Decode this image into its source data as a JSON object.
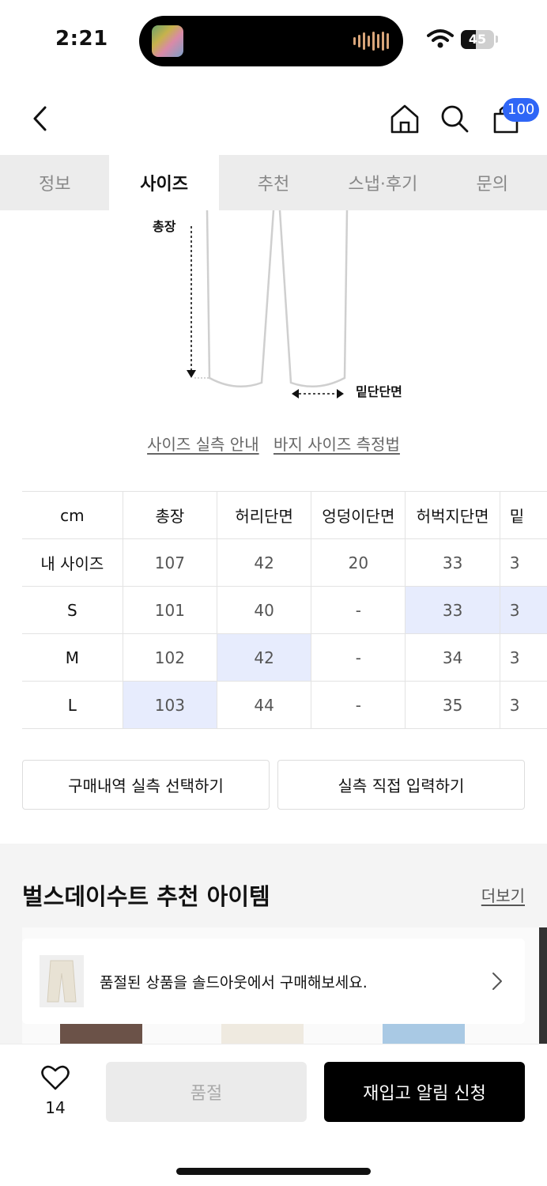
{
  "status_bar": {
    "time": "2:21",
    "battery": "45",
    "battery_level": 0.45
  },
  "header": {
    "cart_count": "100"
  },
  "tabs": [
    {
      "label": "정보",
      "active": false
    },
    {
      "label": "사이즈",
      "active": true
    },
    {
      "label": "추천",
      "active": false
    },
    {
      "label": "스냅·후기",
      "active": false
    },
    {
      "label": "문의",
      "active": false
    }
  ],
  "diagram": {
    "total_length_label": "총장",
    "hem_label": "밑단단면"
  },
  "links": {
    "size_guide": "사이즈 실측 안내",
    "measure_guide": "바지 사이즈 측정법"
  },
  "size_table": {
    "headers": [
      "cm",
      "총장",
      "허리단면",
      "엉덩이단면",
      "허벅지단면",
      "밑"
    ],
    "rows": [
      {
        "label": "내 사이즈",
        "cells": [
          "107",
          "42",
          "20",
          "33",
          "3"
        ]
      },
      {
        "label": "S",
        "cells": [
          "101",
          "40",
          "-",
          "33",
          "3"
        ]
      },
      {
        "label": "M",
        "cells": [
          "102",
          "42",
          "-",
          "34",
          "3"
        ]
      },
      {
        "label": "L",
        "cells": [
          "103",
          "44",
          "-",
          "35",
          "3"
        ]
      }
    ]
  },
  "buttons": {
    "purchase_history": "구매내역 실측 선택하기",
    "direct_input": "실측 직접 입력하기"
  },
  "recommend": {
    "title": "벌스데이수트 추천 아이템",
    "more": "더보기",
    "soldout_notice": "품절된 상품을 솔드아웃에서 구매해보세요."
  },
  "bottom": {
    "like_count": "14",
    "soldout_label": "품절",
    "restock_label": "재입고 알림 신청"
  },
  "colors": {
    "accent_blue": "#2f66f6",
    "highlight": "#e7ecfd"
  }
}
